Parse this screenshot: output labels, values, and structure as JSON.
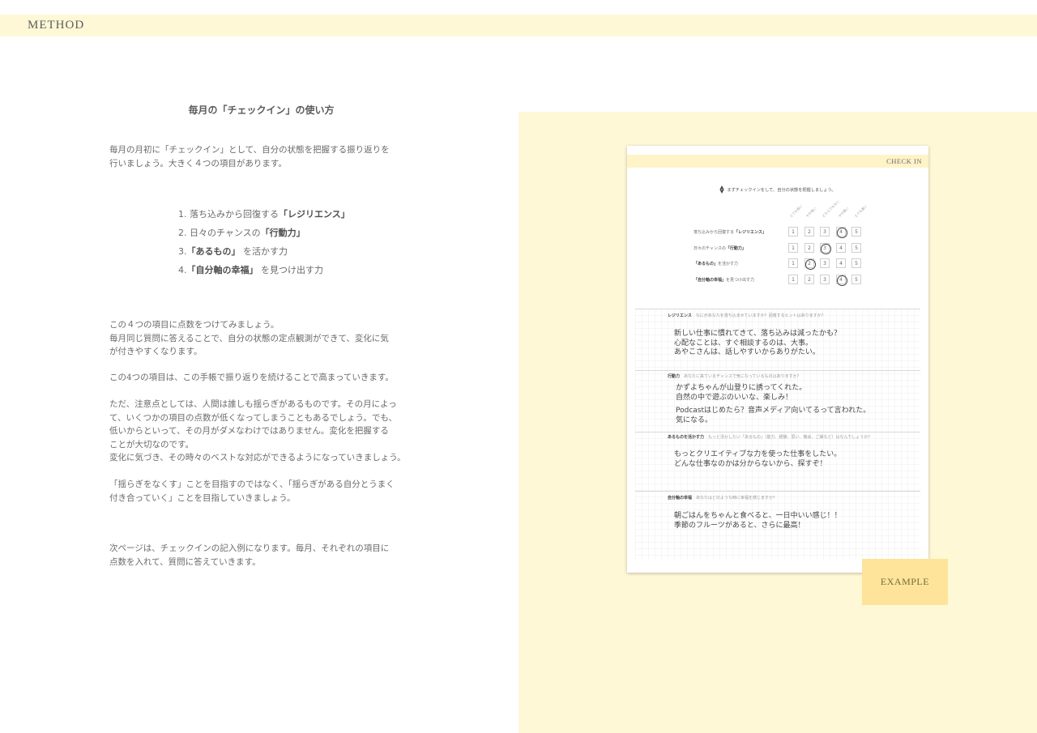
{
  "header": {
    "label": "METHOD"
  },
  "title": "毎月の「チェックイン」の使い方",
  "intro": [
    "毎月の月初に「チェックイン」として、自分の状態を把握する振り返りを",
    "行いましょう。大きく４つの項目があります。"
  ],
  "items": [
    {
      "num": "1.",
      "pre": "落ち込みから回復する",
      "bold": "「レジリエンス」",
      "post": ""
    },
    {
      "num": "2.",
      "pre": "日々のチャンスの",
      "bold": "「行動力」",
      "post": ""
    },
    {
      "num": "3.",
      "pre": "",
      "bold": "「あるもの」",
      "post": "を活かす力"
    },
    {
      "num": "4.",
      "pre": "",
      "bold": "「自分軸の幸福」",
      "post": "を見つけ出す力"
    }
  ],
  "para1": [
    "この４つの項目に点数をつけてみましょう。",
    "毎月同じ質問に答えることで、自分の状態の定点観測ができて、変化に気",
    "が付きやすくなります。"
  ],
  "para2": [
    "この4つの項目は、この手帳で振り返りを続けることで高まっていきます。"
  ],
  "para3": [
    "ただ、注意点としては、人間は誰しも揺らぎがあるものです。その月によっ",
    "て、いくつかの項目の点数が低くなってしまうこともあるでしょう。でも、",
    "低いからといって、その月がダメなわけではありません。変化を把握する",
    "ことが大切なのです。",
    "変化に気づき、その時々のベストな対応ができるようになっていきましょう。"
  ],
  "para4": [
    "「揺らぎをなくす」ことを目指すのではなく、「揺らぎがある自分とうまく",
    "付き合っていく」ことを目指していきましょう。"
  ],
  "para5": [
    "次ページは、チェックインの記入例になります。毎月、それぞれの項目に",
    "点数を入れて、質問に答えていきます。"
  ],
  "example_sheet": {
    "header": "CHECK IN",
    "intro": "まずチェックインをして、自分の状態を把握しましょう。",
    "scale_headers": [
      "とても低い",
      "やや低い",
      "どちらでもない",
      "やや高い",
      "とても高い"
    ],
    "scale": [
      "1",
      "2",
      "3",
      "4",
      "5"
    ],
    "rows": [
      {
        "pre": "落ち込みから回復する",
        "bold": "「レジリエンス」",
        "post": "",
        "score": 4
      },
      {
        "pre": "日々のチャンスの",
        "bold": "「行動力」",
        "post": "",
        "score": 3
      },
      {
        "pre": "",
        "bold": "「あるもの」",
        "post": "を活かす力",
        "score": 2
      },
      {
        "pre": "",
        "bold": "「自分軸の幸福」",
        "post": "を見つけ出す力",
        "score": 4
      }
    ],
    "sections": [
      {
        "title": "レジリエンス",
        "question": "なにがあなたを落ち込ませていますか？回復するヒントはありますか？",
        "answer": [
          "新しい仕事に慣れてきて、落ち込みは減ったかも？",
          "心配なことは、すぐ相談するのは、大事。",
          "あやこさんは、話しやすいからありがたい。"
        ]
      },
      {
        "title": "行動力",
        "question": "あなたに来ているチャンスで気になっているものはありますか？",
        "answer": [
          "かずよちゃんが山登りに誘ってくれた。",
          "自然の中で遊ぶのいいな、楽しみ！",
          "Podcastはじめたら？音声メディア向いてるって言われた。",
          "気になる。"
        ]
      },
      {
        "title": "あるものを活かす力",
        "question": "もっと活かしたい「あるもの」（能力、経験、思い、機会、ご縁など）はなんでしょうか？",
        "answer": [
          "もっとクリエイティブな力を使った仕事をしたい。",
          "どんな仕事なのかは分からないから、探すぞ！"
        ]
      },
      {
        "title": "自分軸の幸福",
        "question": "あなたはどのような時に幸福を感じますか？",
        "answer": [
          "朝ごはんをちゃんと食べると、一日中いい感じ！！",
          "季節のフルーツがあると、さらに最高！"
        ]
      }
    ]
  },
  "example_label": "EXAMPLE",
  "colors": {
    "header_band": "#fff8d6",
    "panel": "#fff8d6",
    "example_box": "#fde49a"
  }
}
